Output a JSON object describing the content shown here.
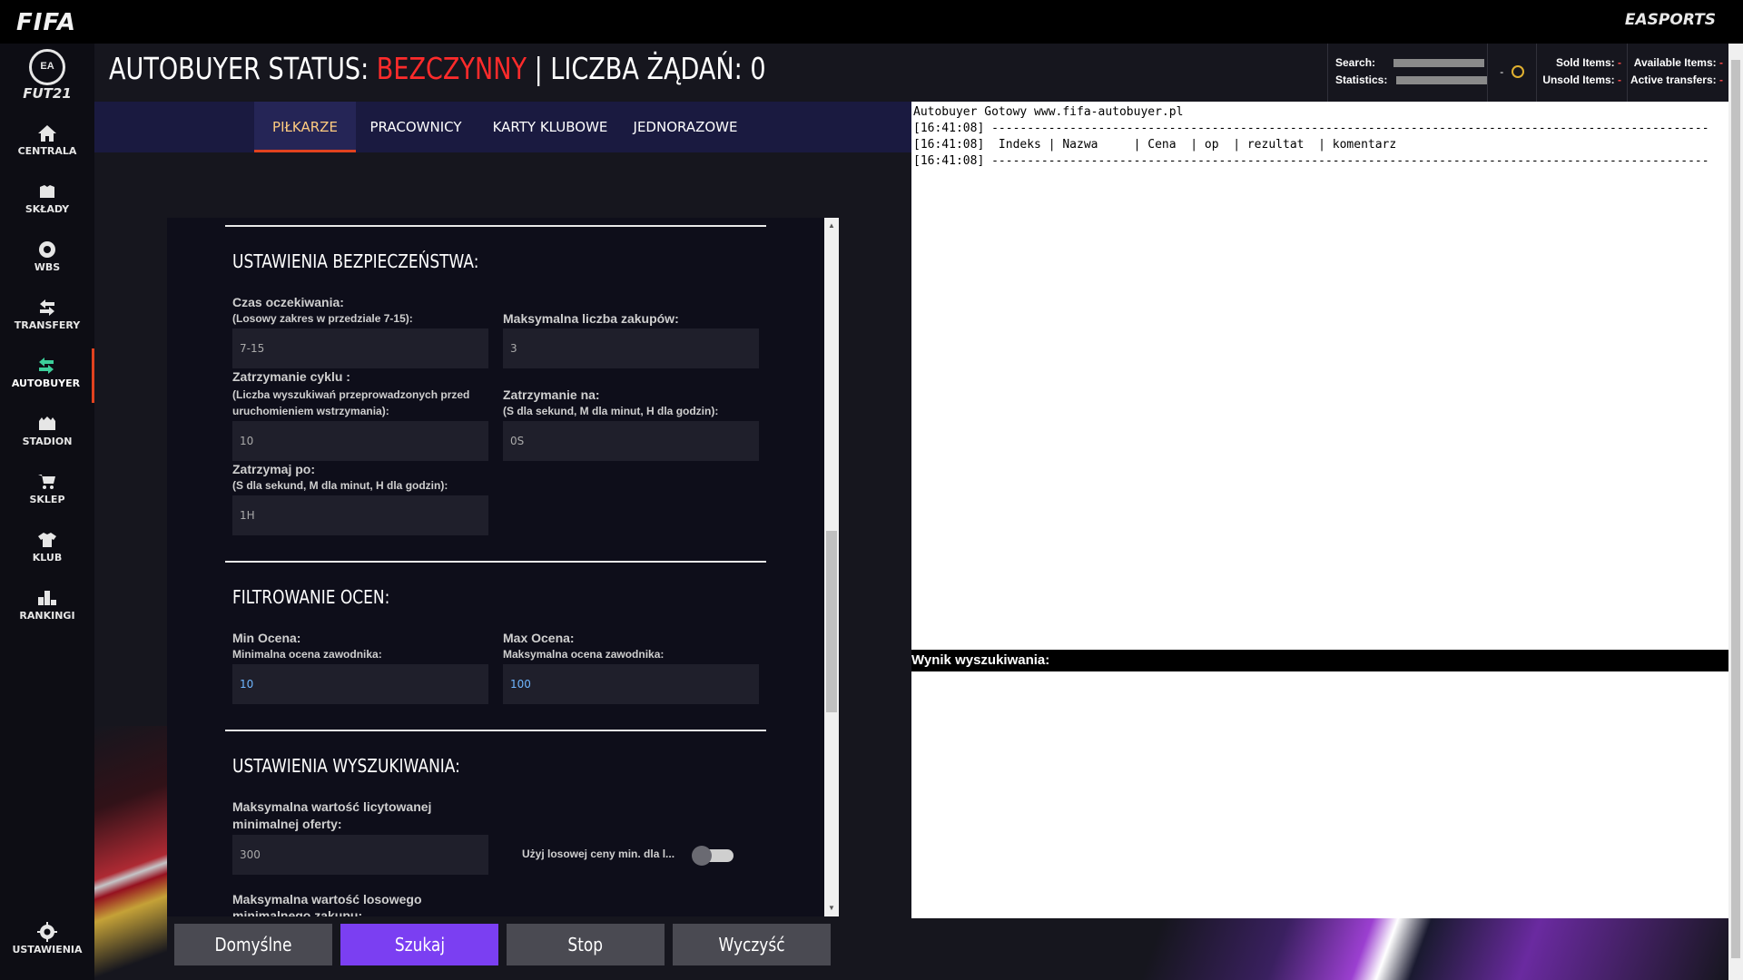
{
  "topbar": {
    "left_logo": "FIFA",
    "right_logo": "EASPORTS"
  },
  "sidebar": {
    "brand_badge": "EA SPORTS",
    "brand_text": "FUT21",
    "items": [
      {
        "label": "CENTRALA",
        "icon": "home-icon"
      },
      {
        "label": "SKŁADY",
        "icon": "squad-icon"
      },
      {
        "label": "WBS",
        "icon": "ball-icon"
      },
      {
        "label": "TRANSFERY",
        "icon": "transfer-arrows-icon"
      },
      {
        "label": "AUTOBUYER",
        "icon": "autobuyer-arrows-icon"
      },
      {
        "label": "STADION",
        "icon": "stadium-icon"
      },
      {
        "label": "SKLEP",
        "icon": "cart-icon"
      },
      {
        "label": "KLUB",
        "icon": "shirt-icon"
      },
      {
        "label": "RANKINGI",
        "icon": "leaderboard-icon"
      }
    ],
    "settings_label": "USTAWIENIA",
    "active_color": "#3ccf9a",
    "active_border": "#e1421f"
  },
  "header": {
    "status_prefix": "AUTOBUYER STATUS: ",
    "status_value": "BEZCZYNNY",
    "status_suffix": " | LICZBA ŻĄDAŃ: 0",
    "status_value_color": "#ff2b2b",
    "search_label": "Search:",
    "statistics_label": "Statistics:",
    "coin_dash": "-",
    "sold_label": "Sold Items:",
    "sold_value": "-",
    "unsold_label": "Unsold Items:",
    "unsold_value": "-",
    "available_label": "Available Items:",
    "available_value": "-",
    "active_label": "Active transfers:",
    "active_value": "-"
  },
  "tabs": [
    {
      "label": "PIŁKARZE",
      "active": true
    },
    {
      "label": "PRACOWNICY",
      "active": false
    },
    {
      "label": "KARTY KLUBOWE",
      "active": false
    },
    {
      "label": "JEDNORAZOWE",
      "active": false
    }
  ],
  "security": {
    "title": "USTAWIENIA BEZPIECZEŃSTWA:",
    "wait_label": "Czas oczekiwania:",
    "wait_sub": "(Losowy zakres w przedziale 7-15):",
    "wait_value": "7-15",
    "max_buys_label": "Maksymalna liczba zakupów:",
    "max_buys_value": "3",
    "cycle_label": "Zatrzymanie cyklu :",
    "cycle_sub1": "(Liczba wyszukiwań przeprowadzonych przed",
    "cycle_sub2": "uruchomieniem wstrzymania):",
    "cycle_value": "10",
    "pause_for_label": "Zatrzymanie na:",
    "pause_for_sub": "(S dla sekund, M dla minut, H dla godzin):",
    "pause_for_value": "0S",
    "stop_after_label": "Zatrzymaj po:",
    "stop_after_sub": "(S dla sekund, M dla minut, H dla godzin):",
    "stop_after_value": "1H"
  },
  "rating": {
    "title": "FILTROWANIE OCEN:",
    "min_label": "Min Ocena:",
    "min_sub": "Minimalna ocena zawodnika:",
    "min_value": "10",
    "max_label": "Max Ocena:",
    "max_sub": "Maksymalna ocena zawodnika:",
    "max_value": "100"
  },
  "search_settings": {
    "title": "USTAWIENIA WYSZUKIWANIA:",
    "max_bid_label1": "Maksymalna wartość licytowanej",
    "max_bid_label2": "minimalnej oferty:",
    "max_bid_value": "300",
    "random_min_label": "Użyj losowej ceny min. dla l...",
    "random_min_enabled": false,
    "max_random_label1": "Maksymalna wartość losowego",
    "max_random_label2": "minimalnego zakupu:"
  },
  "buttons": {
    "default": "Domyślne",
    "search": "Szukaj",
    "stop": "Stop",
    "clear": "Wyczyść",
    "search_color": "#7b3ff2",
    "grey_color": "#4a4a52"
  },
  "log": {
    "lines": [
      "Autobuyer Gotowy www.fifa-autobuyer.pl",
      "[16:41:08] -----------------------------------------------------------------------------------------------------",
      "[16:41:08]  Indeks | Nazwa     | Cena  | op  | rezultat  | komentarz",
      "[16:41:08] -----------------------------------------------------------------------------------------------------"
    ]
  },
  "result": {
    "title": "Wynik wyszukiwania:"
  }
}
